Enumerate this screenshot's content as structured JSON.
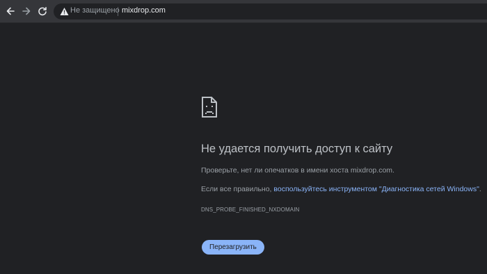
{
  "toolbar": {
    "back_icon": "arrow-left-icon",
    "forward_icon": "arrow-right-icon",
    "reload_icon": "reload-icon",
    "security_status": "Не защищено",
    "url": "mixdrop.com"
  },
  "error_page": {
    "icon": "sad-document-icon",
    "title": "Не удается получить доступ к сайту",
    "check_text": "Проверьте, нет ли опечатков в имени хоста mixdrop.com.",
    "suggestion_prefix": "Если все правильно, ",
    "suggestion_link": "воспользуйтесь инструментом \"Диагностика сетей Windows\"",
    "suggestion_suffix": ".",
    "error_code": "DNS_PROBE_FINISHED_NXDOMAIN",
    "reload_button": "Перезагрузить"
  },
  "colors": {
    "background": "#202124",
    "toolbar": "#35363a",
    "link": "#8ab4f8",
    "button": "#8ab4f8"
  }
}
